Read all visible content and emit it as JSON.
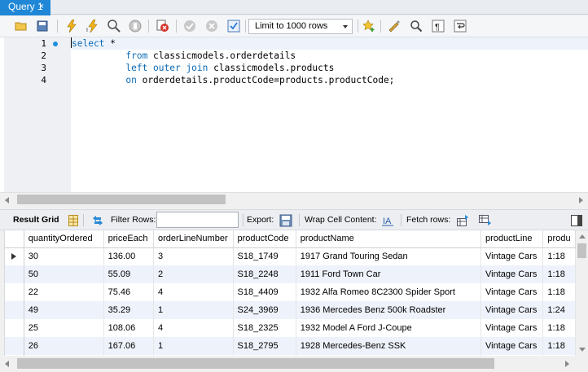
{
  "tab": {
    "label": "Query 1",
    "close": "×"
  },
  "toolbar": {
    "limit_select": "Limit to 1000 rows",
    "icons": [
      "open-folder-icon",
      "save-icon",
      "execute-icon",
      "execute-current-icon",
      "explain-icon",
      "stop-icon",
      "toggle-error-icon",
      "commit-icon",
      "rollback-icon",
      "autocommit-icon",
      "bookmark-icon",
      "beautify-icon",
      "find-icon",
      "invisible-chars-icon",
      "wrap-icon"
    ]
  },
  "editor": {
    "line_numbers": [
      "1",
      "2",
      "3",
      "4"
    ],
    "lines": [
      [
        {
          "t": "kw",
          "v": "select"
        },
        {
          "t": "tx",
          "v": " *"
        }
      ],
      [
        {
          "t": "tx",
          "v": "          "
        },
        {
          "t": "kw",
          "v": "from"
        },
        {
          "t": "tx",
          "v": " classicmodels.orderdetails"
        }
      ],
      [
        {
          "t": "tx",
          "v": "          "
        },
        {
          "t": "kw",
          "v": "left outer join"
        },
        {
          "t": "tx",
          "v": " classicmodels.products"
        }
      ],
      [
        {
          "t": "tx",
          "v": "          "
        },
        {
          "t": "kw",
          "v": "on"
        },
        {
          "t": "tx",
          "v": " orderdetails.productCode=products.productCode;"
        }
      ]
    ]
  },
  "result_toolbar": {
    "result_grid": "Result Grid",
    "filter_rows": "Filter Rows:",
    "filter_value": "",
    "export": "Export:",
    "wrap_cell": "Wrap Cell Content:",
    "fetch_rows": "Fetch rows:"
  },
  "grid": {
    "columns": [
      "quantityOrdered",
      "priceEach",
      "orderLineNumber",
      "productCode",
      "productName",
      "productLine",
      "produ"
    ],
    "rows": [
      [
        "30",
        "136.00",
        "3",
        "S18_1749",
        "1917 Grand Touring Sedan",
        "Vintage Cars",
        "1:18"
      ],
      [
        "50",
        "55.09",
        "2",
        "S18_2248",
        "1911 Ford Town Car",
        "Vintage Cars",
        "1:18"
      ],
      [
        "22",
        "75.46",
        "4",
        "S18_4409",
        "1932 Alfa Romeo 8C2300 Spider Sport",
        "Vintage Cars",
        "1:18"
      ],
      [
        "49",
        "35.29",
        "1",
        "S24_3969",
        "1936 Mercedes Benz 500k Roadster",
        "Vintage Cars",
        "1:24"
      ],
      [
        "25",
        "108.06",
        "4",
        "S18_2325",
        "1932 Model A Ford J-Coupe",
        "Vintage Cars",
        "1:18"
      ],
      [
        "26",
        "167.06",
        "1",
        "S18_2795",
        "1928 Mercedes-Benz SSK",
        "Vintage Cars",
        "1:18"
      ],
      [
        "",
        "",
        "",
        "",
        "",
        "",
        ""
      ]
    ],
    "selected_row": 0
  },
  "colors": {
    "tab_active": "#1f87d6",
    "keyword": "#0c6ab5",
    "row_alt": "#eef2fb"
  }
}
